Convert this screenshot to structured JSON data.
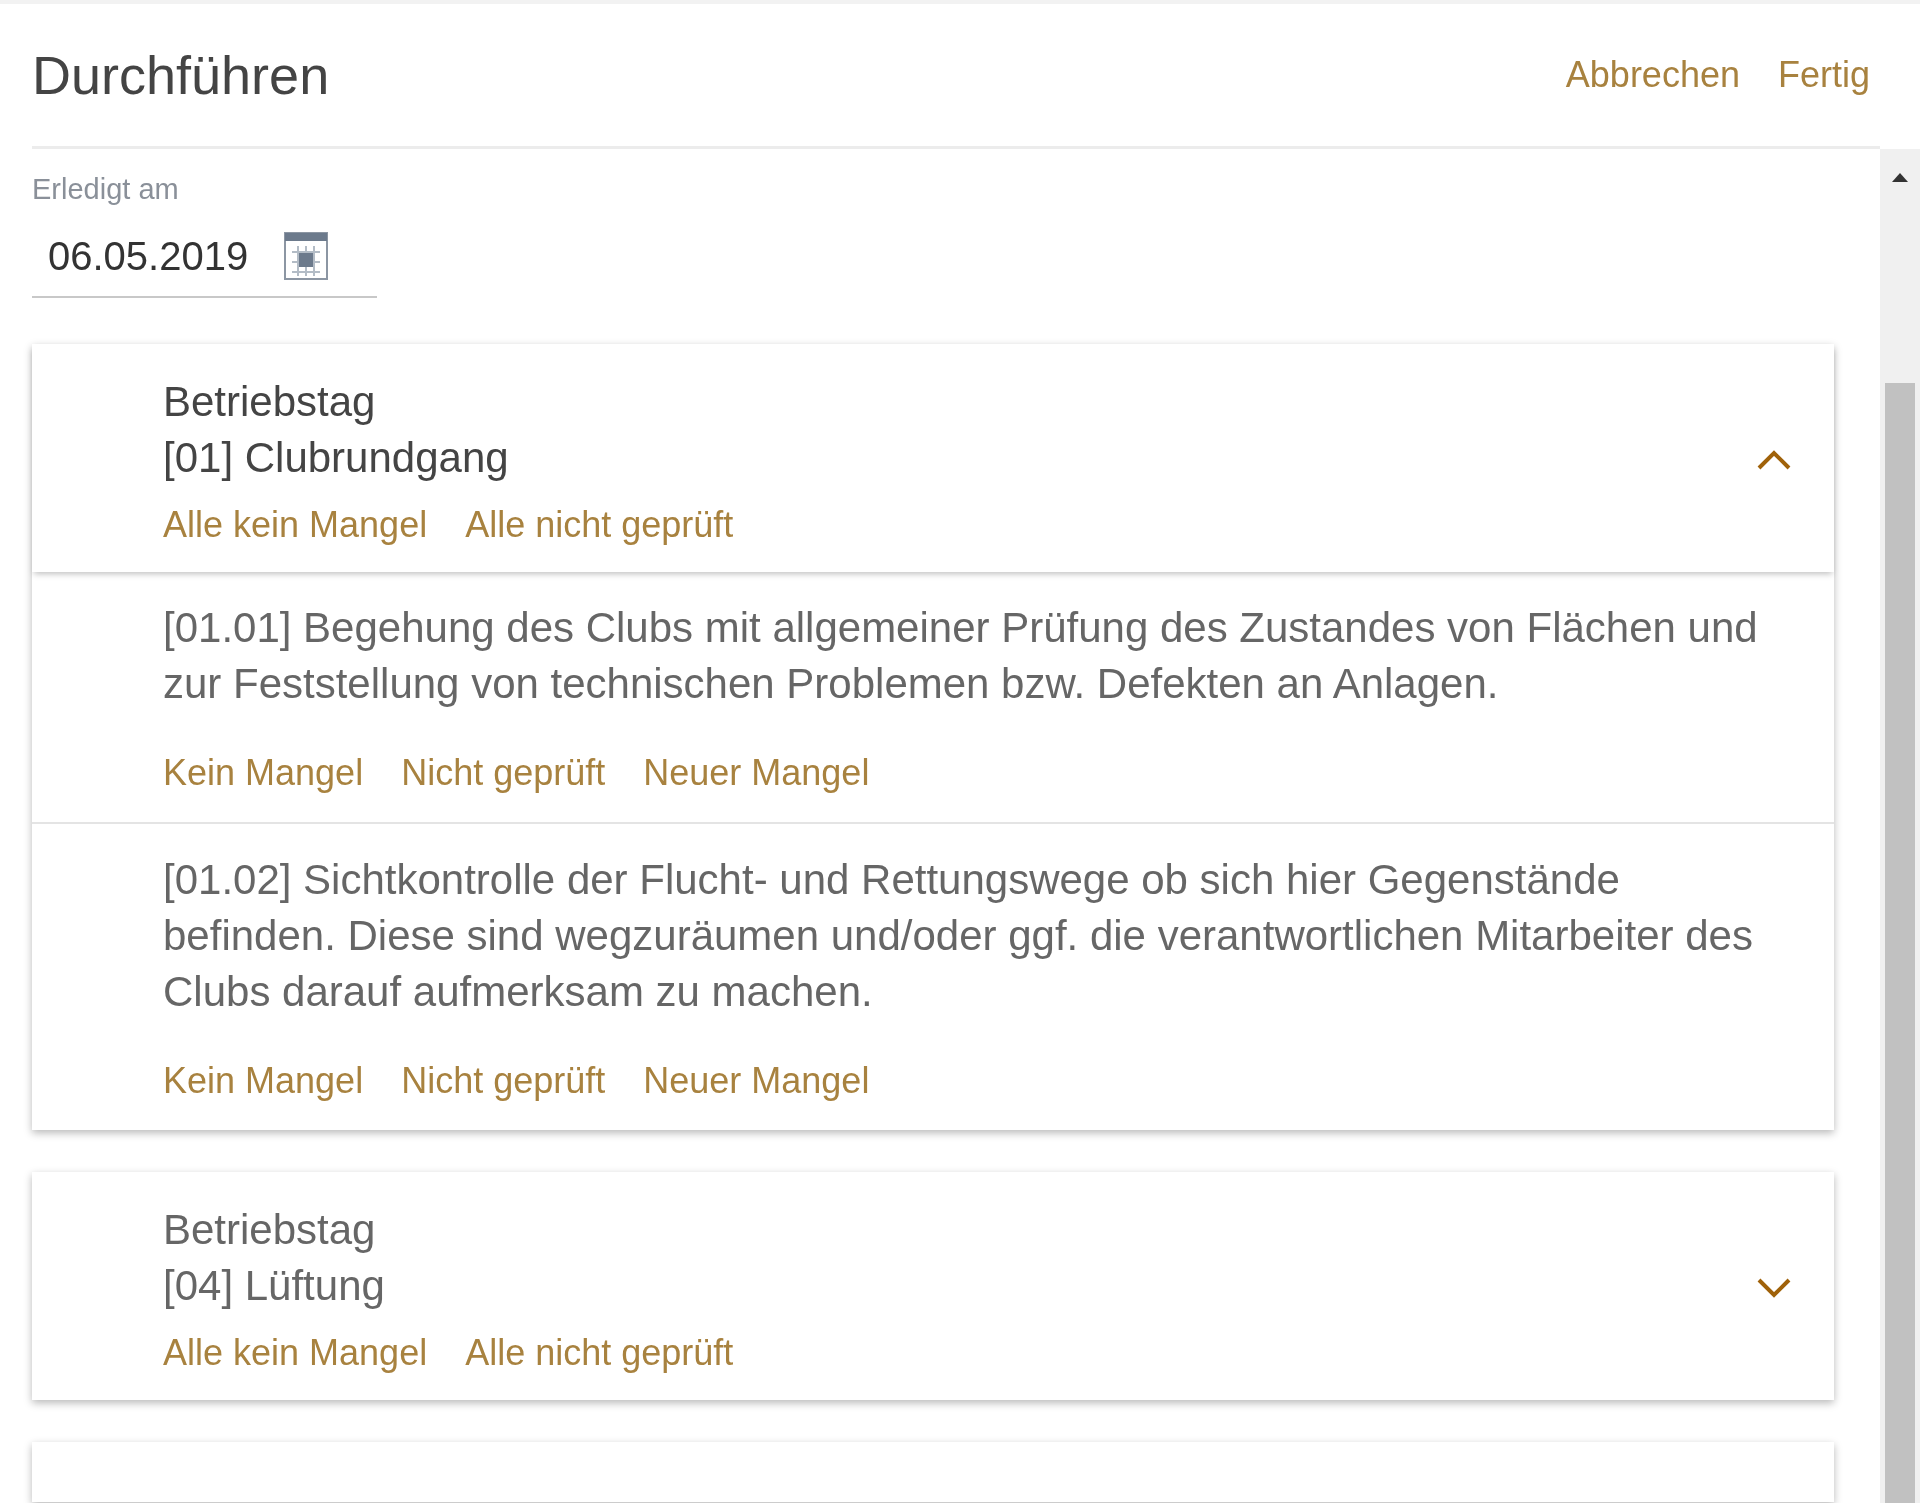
{
  "title": "Durchführen",
  "actions": [
    "Abbrechen",
    "Fertig"
  ],
  "date_field": {
    "label": "Erledigt am",
    "value": "06.05.2019"
  },
  "groups": [
    {
      "category": "Betriebstag",
      "title": "[01] Clubrundgang",
      "expanded": true,
      "bulk_actions": [
        "Alle kein Mangel",
        "Alle nicht geprüft"
      ],
      "items": [
        {
          "text": "[01.01] Begehung des Clubs mit allgemeiner Prüfung des Zustandes von Flächen und zur Feststellung von technischen Problemen bzw. Defekten an Anlagen.",
          "actions": [
            "Kein Mangel",
            "Nicht geprüft",
            "Neuer Mangel"
          ]
        },
        {
          "text": "[01.02] Sichtkontrolle der Flucht- und Rettungswege ob sich hier Gegenstände befinden. Diese sind wegzuräumen und/oder ggf. die verantwortlichen Mitarbeiter des Clubs darauf aufmerksam zu machen.",
          "actions": [
            "Kein Mangel",
            "Nicht geprüft",
            "Neuer Mangel"
          ]
        }
      ]
    },
    {
      "category": "Betriebstag",
      "title": "[04] Lüftung",
      "expanded": false,
      "bulk_actions": [
        "Alle kein Mangel",
        "Alle nicht geprüft"
      ]
    }
  ]
}
